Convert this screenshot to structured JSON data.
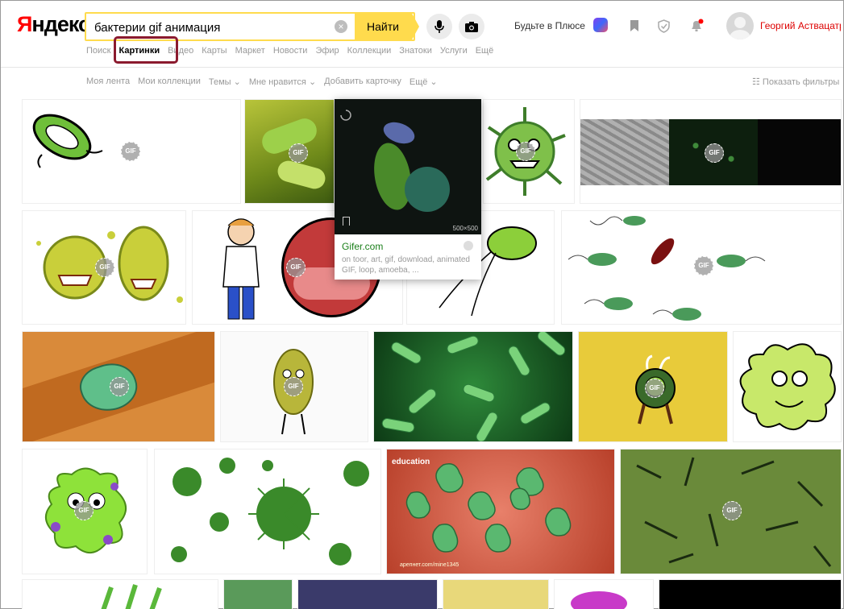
{
  "header": {
    "logo_first": "Я",
    "logo_rest": "ндекс",
    "search_value": "бактерии gif анимация",
    "clear_label": "×",
    "find_label": "Найти",
    "promo_text": "Будьте в Плюсе",
    "user_name": "Георгий Аствацатрян"
  },
  "services": [
    {
      "label": "Поиск"
    },
    {
      "label": "Картинки",
      "active": true
    },
    {
      "label": "Видео"
    },
    {
      "label": "Карты"
    },
    {
      "label": "Маркет"
    },
    {
      "label": "Новости"
    },
    {
      "label": "Эфир"
    },
    {
      "label": "Коллекции"
    },
    {
      "label": "Знатоки"
    },
    {
      "label": "Услуги"
    },
    {
      "label": "Ещё"
    }
  ],
  "subnav": [
    "Моя лента",
    "Мои коллекции",
    "Темы ⌄",
    "Мне нравится ⌄",
    "Добавить карточку",
    "Ещё ⌄"
  ],
  "filters_label": "☷ Показать фильтры",
  "gif_badge": "GIF",
  "preview": {
    "size": "500×500",
    "source": "Gifer.com",
    "desc": "on toor, art, gif, download, animated GIF, loop, amoeba, ..."
  },
  "overlay_texts": {
    "education": "education",
    "watermark": "apeпнет.com/mine1345"
  },
  "colors": {
    "search_border": "#ffdb4d",
    "highlight_box": "#8b1a2e",
    "logo_red": "#ff0000",
    "username_red": "#dd0000"
  }
}
